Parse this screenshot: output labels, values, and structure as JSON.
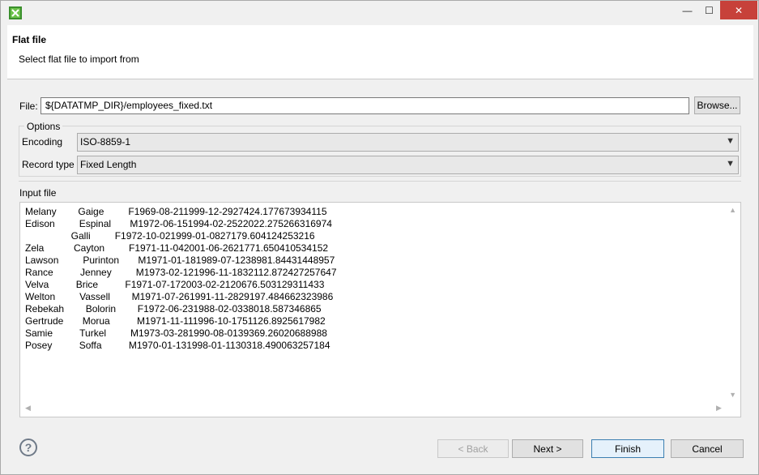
{
  "window": {
    "app_icon": "green-x-icon",
    "controls": {
      "minimize": "—",
      "maximize": "☐",
      "close": "✕"
    }
  },
  "header": {
    "title": "Flat file",
    "subtitle": "Select flat file to import from"
  },
  "file": {
    "label": "File:",
    "value": "${DATATMP_DIR}/employees_fixed.txt",
    "browse_label": "Browse..."
  },
  "options": {
    "legend": "Options",
    "encoding_label": "Encoding",
    "encoding_value": "ISO-8859-1",
    "record_type_label": "Record type",
    "record_type_value": "Fixed Length"
  },
  "input_file": {
    "label": "Input file",
    "lines": [
      "Melany        Gaige         F1969-08-211999-12-2927424.177673934115",
      "Edison         Espinal       M1972-06-151994-02-2522022.275266316974",
      "                 Galli         F1972-10-021999-01-0827179.604124253216",
      "Zela           Cayton         F1971-11-042001-06-2621771.650410534152",
      "Lawson         Purinton       M1971-01-181989-07-1238981.84431448957",
      "Rance          Jenney         M1973-02-121996-11-1832112.872427257647",
      "Velva          Brice          F1971-07-172003-02-2120676.503129311433",
      "Welton         Vassell        M1971-07-261991-11-2829197.484662323986",
      "Rebekah        Bolorin        F1972-06-231988-02-0338018.587346865",
      "Gertrude       Morua          M1971-11-111996-10-1751126.8925617982",
      "Samie          Turkel         M1973-03-281990-08-0139369.26020688988",
      "Posey          Soffa          M1970-01-131998-01-1130318.490063257184"
    ]
  },
  "footer": {
    "help_icon": "question-circle-icon",
    "back_label": "< Back",
    "next_label": "Next >",
    "finish_label": "Finish",
    "cancel_label": "Cancel"
  }
}
